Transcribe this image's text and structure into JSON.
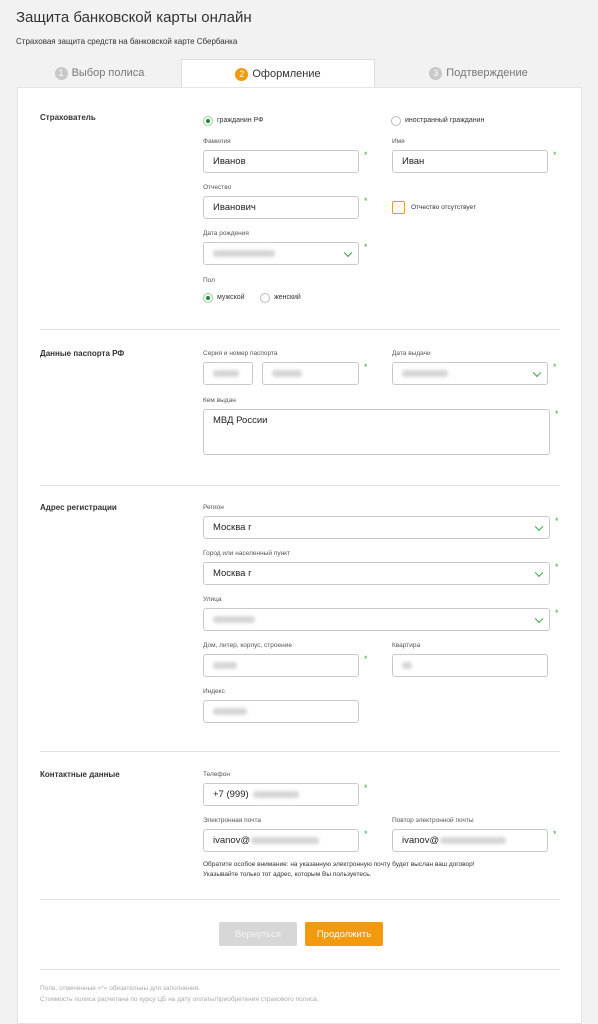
{
  "header": {
    "title": "Защита банковской карты онлайн",
    "subtitle": "Страховая защита средств на банковской карте Сбербанка"
  },
  "steps": [
    {
      "num": "1",
      "label": "Выбор полиса",
      "active": false
    },
    {
      "num": "2",
      "label": "Оформление",
      "active": true
    },
    {
      "num": "3",
      "label": "Подтверждение",
      "active": false
    }
  ],
  "insurer": {
    "section_label": "Страхователь",
    "citizenship_options": [
      "гражданин РФ",
      "иностранный гражданин"
    ],
    "citizenship_selected": "гражданин РФ",
    "surname_label": "Фамилия",
    "surname_value": "Иванов",
    "name_label": "Имя",
    "name_value": "Иван",
    "patronymic_label": "Отчество",
    "patronymic_value": "Иванович",
    "no_patronymic_label": "Отчество отсутствует",
    "birthdate_label": "Дата рождения",
    "gender_label": "Пол",
    "gender_options": [
      "мужской",
      "женский"
    ],
    "gender_selected": "мужской"
  },
  "passport": {
    "section_label": "Данные паспорта РФ",
    "series_label": "Серия и номер паспорта",
    "issue_date_label": "Дата выдачи",
    "issued_by_label": "Кем выдан",
    "issued_by_value": "МВД России"
  },
  "address": {
    "section_label": "Адрес регистрации",
    "region_label": "Регион",
    "region_value": "Москва г",
    "city_label": "Город или населенный пункт",
    "city_value": "Москва г",
    "street_label": "Улица",
    "house_label": "Дом, литер, корпус, строение",
    "apartment_label": "Квартира",
    "index_label": "Индекс"
  },
  "contacts": {
    "section_label": "Контактные данные",
    "phone_label": "Телефон",
    "phone_prefix": "+7 (999)",
    "email_label": "Электронная почта",
    "email_prefix": "ivanov@",
    "email_repeat_label": "Повтор электронной почты",
    "email_repeat_prefix": "ivanov@",
    "note_line1": "Обратите особое внимание: на указанную электронную почту будет выслан ваш договор!",
    "note_line2": "Указывайте только тот адрес, которым Вы пользуетесь."
  },
  "actions": {
    "back_label": "Вернуться",
    "continue_label": "Продолжить"
  },
  "footer": {
    "line1": "Поля, отмеченные «*» обязательны для заполнения.",
    "line2": "Стоимость полиса расчитана по курсу ЦБ на дату оплаты/приобретения страхового полиса."
  },
  "required_mark": "*",
  "colors": {
    "accent": "#f29a0e",
    "success": "#1b8a2a",
    "required": "#4ba34e"
  }
}
